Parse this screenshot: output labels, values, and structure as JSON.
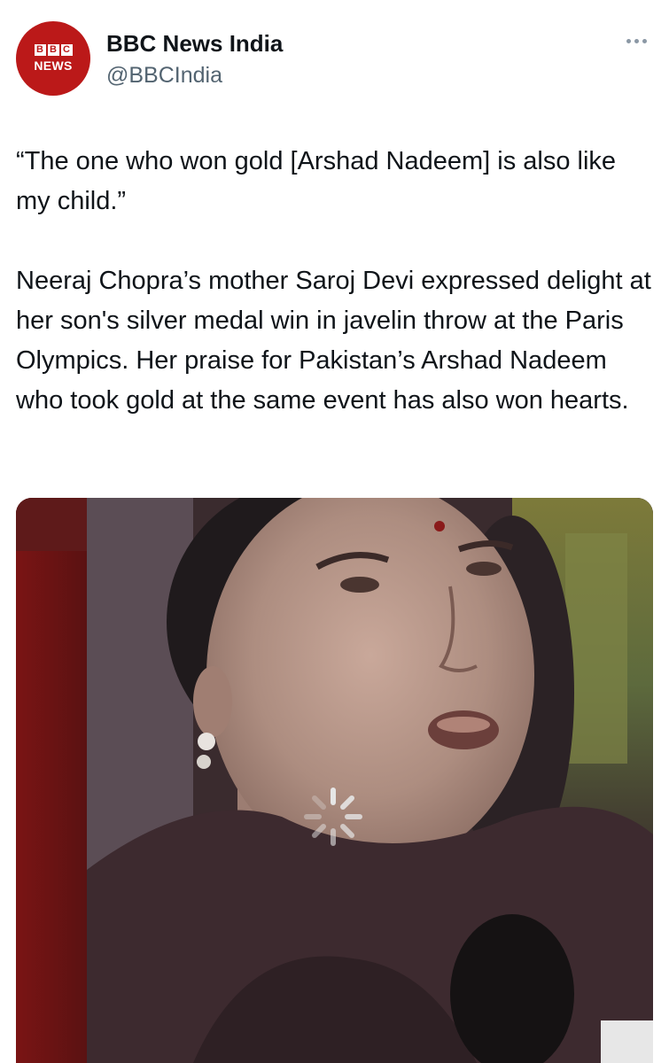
{
  "account": {
    "avatar_blocks": [
      "B",
      "B",
      "C"
    ],
    "avatar_word": "NEWS",
    "display_name": "BBC News India",
    "handle": "@BBCIndia",
    "brand_color": "#bb1919"
  },
  "tweet": {
    "paragraphs": [
      "“The one who won gold [Arshad Nadeem] is also like my child.”",
      "Neeraj Chopra’s mother Saroj Devi expressed delight at her son's silver medal win in javelin throw at the Paris Olympics. Her praise for Pakistan’s Arshad Nadeem who took gold at the same event has also won hearts."
    ]
  },
  "media": {
    "kind": "video",
    "state": "loading",
    "icon": "loading-spinner-icon"
  },
  "icons": {
    "more": "more-options-icon"
  }
}
